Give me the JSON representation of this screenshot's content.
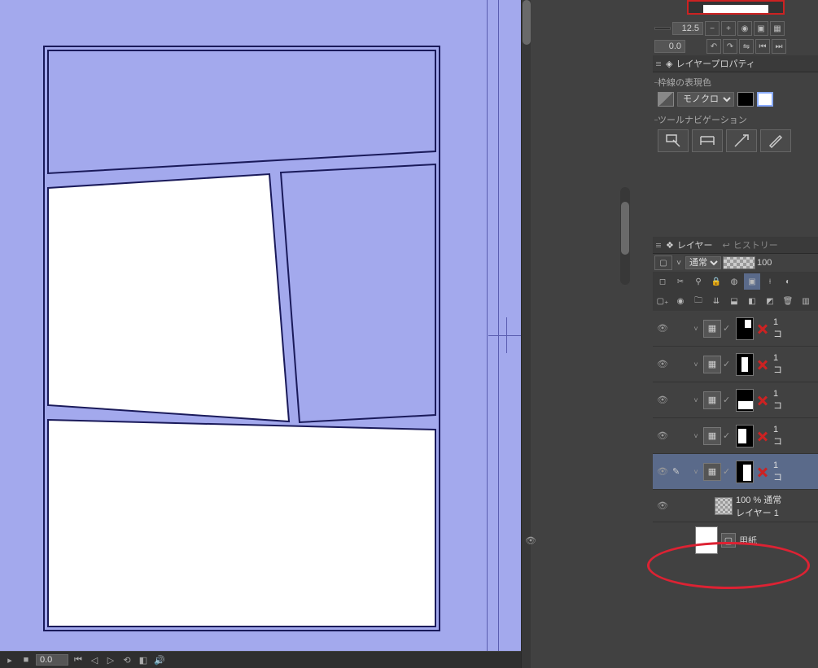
{
  "navigator": {
    "zoom": "12.5",
    "angle": "0.0"
  },
  "layer_property": {
    "tab": "レイヤープロパティ",
    "border_section": "枠線の表現色",
    "mono_label": "モノクロ",
    "tool_nav": "ツールナビゲーション"
  },
  "layers": {
    "tab": "レイヤー",
    "history_tab": "ヒストリー",
    "blend": "通常",
    "opacity": "100",
    "rows": [
      {
        "label": "1",
        "sub": "コ"
      },
      {
        "label": "1",
        "sub": "コ"
      },
      {
        "label": "1",
        "sub": "コ"
      },
      {
        "label": "1",
        "sub": "コ"
      },
      {
        "label": "1",
        "sub": "コ"
      }
    ],
    "folder_text1": "100 % 通常",
    "folder_text2": "レイヤー 1",
    "paper_label": "用紙"
  },
  "statusbar": {
    "val": "0.0"
  }
}
